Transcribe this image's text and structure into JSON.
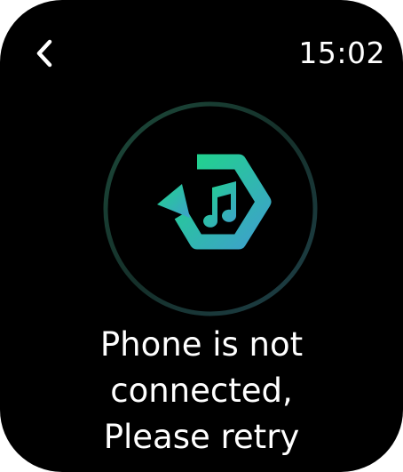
{
  "status_bar": {
    "time": "15:02"
  },
  "navigation": {
    "back_icon": "chevron-left-icon"
  },
  "status_icon": {
    "name": "music-sync-icon",
    "gradient_start": "#22d08a",
    "gradient_end": "#3fa6c9",
    "ring_color": "#1f3b34"
  },
  "message": {
    "lines": [
      "Phone is not",
      "connected,",
      "Please retry"
    ]
  },
  "colors": {
    "background": "#000000",
    "text": "#ffffff"
  }
}
